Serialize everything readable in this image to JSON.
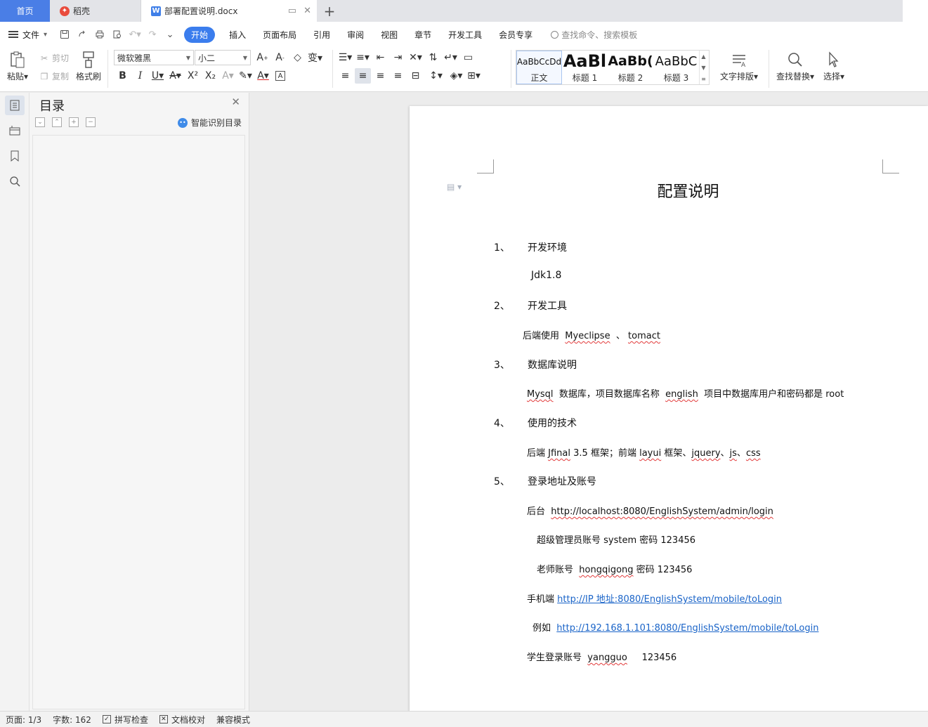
{
  "tabs": {
    "home": "首页",
    "daoke": "稻壳",
    "document": "部署配置说明.docx",
    "new_tab": "+"
  },
  "menu": {
    "file": "文件",
    "items": [
      "开始",
      "插入",
      "页面布局",
      "引用",
      "审阅",
      "视图",
      "章节",
      "开发工具",
      "会员专享"
    ],
    "search_placeholder": "查找命令、搜索模板"
  },
  "ribbon": {
    "paste": "粘贴",
    "cut": "剪切",
    "copy": "复制",
    "format_painter": "格式刷",
    "font_name": "微软雅黑",
    "font_size": "小二",
    "styles": [
      {
        "sample": "AaBbCcDd",
        "name": "正文"
      },
      {
        "sample": "AaBl",
        "name": "标题 1"
      },
      {
        "sample": "AaBb(",
        "name": "标题 2"
      },
      {
        "sample": "AaBbC",
        "name": "标题 3"
      }
    ],
    "text_layout": "文字排版",
    "find_replace": "查找替换",
    "select": "选择"
  },
  "toc": {
    "title": "目录",
    "smart_detect": "智能识别目录"
  },
  "document": {
    "title": "配置说明",
    "sections": [
      {
        "num": "1、",
        "heading": "开发环境"
      },
      {
        "num": "2、",
        "heading": "开发工具"
      },
      {
        "num": "3、",
        "heading": "数据库说明"
      },
      {
        "num": "4、",
        "heading": "使用的技术"
      },
      {
        "num": "5、",
        "heading": "登录地址及账号"
      }
    ],
    "jdk": "Jdk1.8",
    "tools_prefix": "后端使用",
    "tool1": "Myeclipse",
    "tools_sep": "、",
    "tool2": "tomact",
    "db_mysql": "Mysql",
    "db_mid": "数据库，项目数据库名称",
    "db_name": "english",
    "db_end": "项目中数据库用户和密码都是  root",
    "tech_a": "后端",
    "tech_jfinal": "Jfinal",
    "tech_b": "3.5  框架；前端",
    "tech_layui": "layui",
    "tech_c": "框架、",
    "tech_jquery": "jquery",
    "tech_d": "、",
    "tech_js": "js",
    "tech_e": "、",
    "tech_css": "css",
    "admin_label": "后台",
    "admin_url": "http://localhost:8080/EnglishSystem/admin/login",
    "super_admin": "超级管理员账号  system 密码  123456",
    "teacher_a": "老师账号",
    "teacher_user": "hongqigong",
    "teacher_b": "密码  123456",
    "mobile_label": "手机端",
    "mobile_url": "http://IP 地址:8080/EnglishSystem/mobile/toLogin",
    "example_label": "例如",
    "example_url": "http://192.168.1.101:8080/EnglishSystem/mobile/toLogin",
    "student_a": "学生登录账号",
    "student_user": "yangguo",
    "student_pwd": "123456"
  },
  "status": {
    "page": "页面: 1/3",
    "words": "字数: 162",
    "spell": "拼写检查",
    "proof": "文档校对",
    "compat": "兼容模式"
  },
  "colors": {
    "accent": "#3b7ded",
    "home_tab": "#4a7ee6",
    "link": "#1a64c8",
    "squiggle": "#e23b3b"
  }
}
